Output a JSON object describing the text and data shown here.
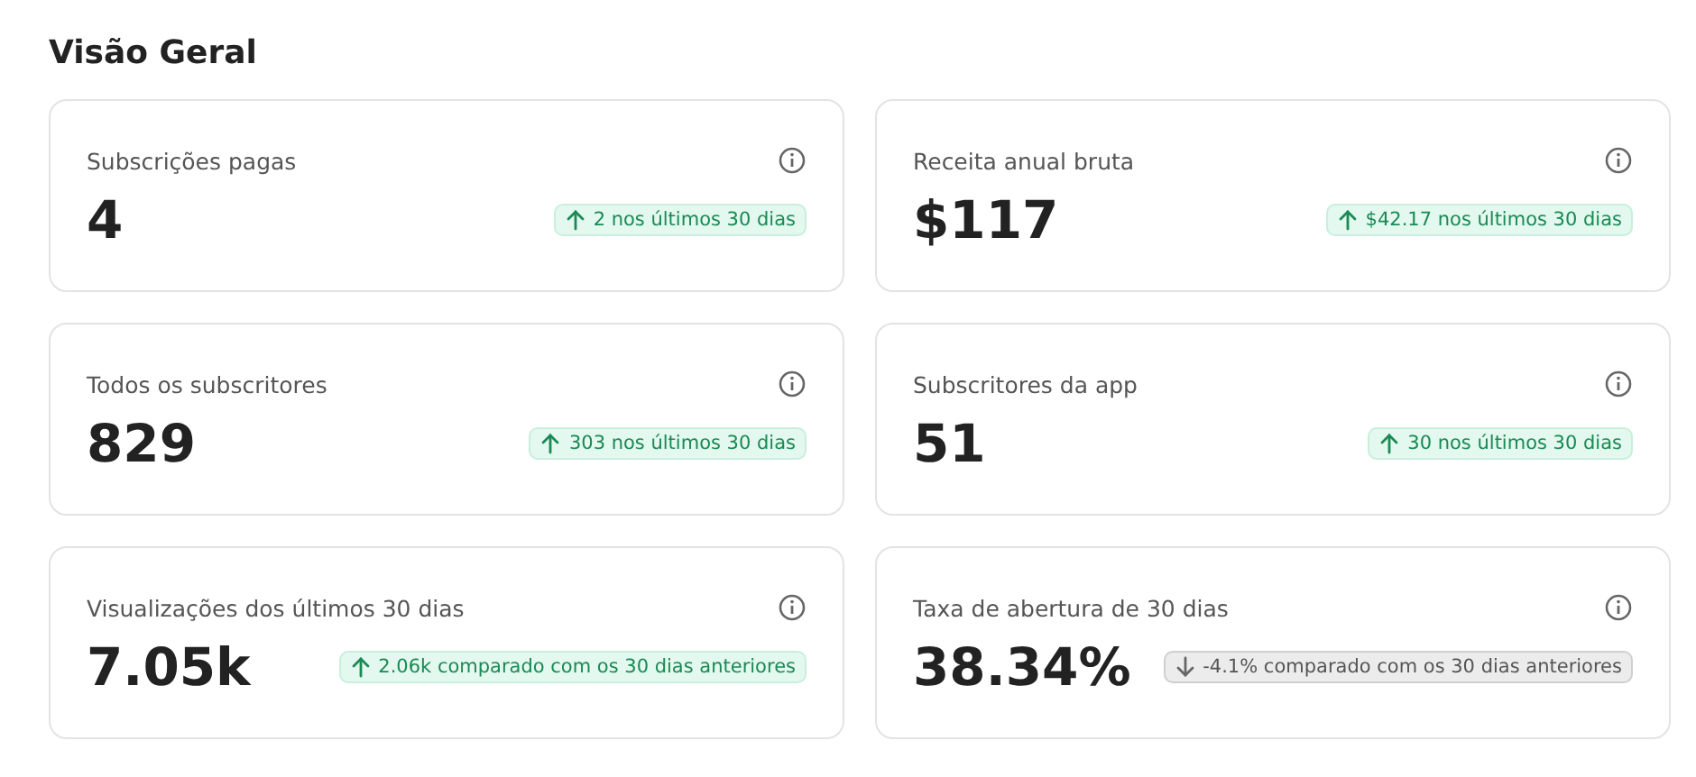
{
  "title": "Visão Geral",
  "cards": [
    {
      "label": "Subscrições pagas",
      "value": "4",
      "kind": "up",
      "change": "2 nos últimos 30 dias"
    },
    {
      "label": "Receita anual bruta",
      "value": "$117",
      "kind": "up",
      "change": "$42.17 nos últimos 30 dias"
    },
    {
      "label": "Todos os subscritores",
      "value": "829",
      "kind": "up",
      "change": "303 nos últimos 30 dias"
    },
    {
      "label": "Subscritores da app",
      "value": "51",
      "kind": "up",
      "change": "30 nos últimos 30 dias"
    },
    {
      "label": "Visualizações dos últimos 30 dias",
      "value": "7.05k",
      "kind": "up",
      "change": "2.06k comparado com os 30 dias anteriores"
    },
    {
      "label": "Taxa de abertura de 30 dias",
      "value": "38.34%",
      "kind": "down",
      "change": "-4.1% comparado com os 30 dias anteriores"
    }
  ]
}
